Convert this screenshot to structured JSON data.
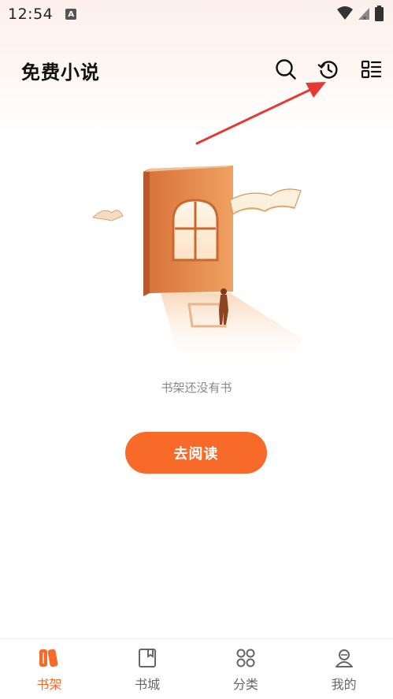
{
  "status_bar": {
    "time": "12:54",
    "icons": [
      "text-a-icon",
      "wifi-icon",
      "signal-icon",
      "battery-icon"
    ]
  },
  "header": {
    "title": "免费小说",
    "icons": [
      "search-icon",
      "history-icon",
      "menu-list-icon"
    ]
  },
  "shelf": {
    "empty_text": "书架还没有书",
    "go_read_label": "去阅读"
  },
  "bottom_nav": {
    "items": [
      {
        "label": "书架",
        "icon": "bookshelf-icon",
        "active": true
      },
      {
        "label": "书城",
        "icon": "bookstore-icon",
        "active": false
      },
      {
        "label": "分类",
        "icon": "category-icon",
        "active": false
      },
      {
        "label": "我的",
        "icon": "profile-icon",
        "active": false
      }
    ]
  },
  "colors": {
    "accent": "#f76a2a",
    "annotation": "#e53935",
    "text_muted": "#888888"
  }
}
